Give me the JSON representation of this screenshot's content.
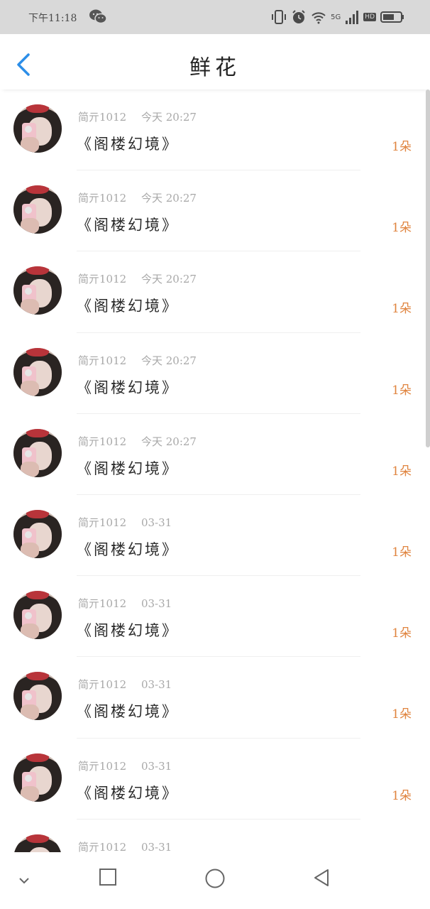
{
  "status_bar": {
    "time": "下午11:18",
    "network": "5G",
    "hd": "HD",
    "icons": [
      "wechat-icon",
      "vibrate-icon",
      "alarm-icon",
      "wifi-icon",
      "signal-icon",
      "battery-icon"
    ]
  },
  "header": {
    "title": "鲜花",
    "back_icon": "chevron-left-icon",
    "accent_color": "#2c8ee8"
  },
  "items": [
    {
      "author": "简亓1012",
      "time": "今天 20:27",
      "book": "《阁楼幻境》",
      "count": "1朵"
    },
    {
      "author": "简亓1012",
      "time": "今天 20:27",
      "book": "《阁楼幻境》",
      "count": "1朵"
    },
    {
      "author": "简亓1012",
      "time": "今天 20:27",
      "book": "《阁楼幻境》",
      "count": "1朵"
    },
    {
      "author": "简亓1012",
      "time": "今天 20:27",
      "book": "《阁楼幻境》",
      "count": "1朵"
    },
    {
      "author": "简亓1012",
      "time": "今天 20:27",
      "book": "《阁楼幻境》",
      "count": "1朵"
    },
    {
      "author": "简亓1012",
      "time": "03-31",
      "book": "《阁楼幻境》",
      "count": "1朵"
    },
    {
      "author": "简亓1012",
      "time": "03-31",
      "book": "《阁楼幻境》",
      "count": "1朵"
    },
    {
      "author": "简亓1012",
      "time": "03-31",
      "book": "《阁楼幻境》",
      "count": "1朵"
    },
    {
      "author": "简亓1012",
      "time": "03-31",
      "book": "《阁楼幻境》",
      "count": "1朵"
    },
    {
      "author": "简亓1012",
      "time": "03-31",
      "book": "",
      "count": ""
    }
  ],
  "colors": {
    "count": "#e0843f",
    "meta": "#a8a8a8",
    "bow": "#b8343a"
  },
  "nav_bar": {
    "icons": [
      "chevron-down-icon",
      "square-icon",
      "circle-icon",
      "triangle-back-icon"
    ]
  }
}
